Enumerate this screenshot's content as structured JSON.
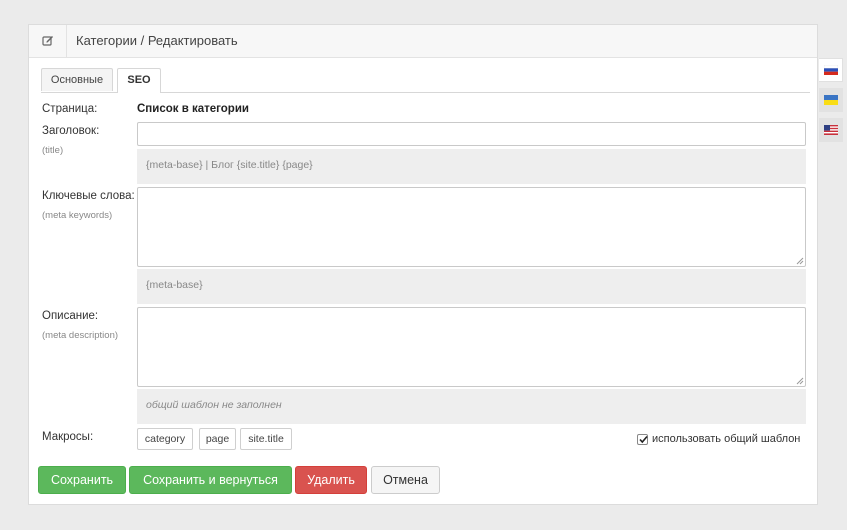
{
  "header": {
    "title": "Категории / Редактировать",
    "icon": "edit-icon"
  },
  "tabs": [
    {
      "label": "Основные",
      "active": false
    },
    {
      "label": "SEO",
      "active": true
    }
  ],
  "form": {
    "page": {
      "label": "Страница:",
      "value": "Список в категории"
    },
    "title": {
      "label": "Заголовок:",
      "sublabel": "(title)",
      "value": "",
      "hint": "{meta-base} | Блог {site.title} {page}"
    },
    "keywords": {
      "label": "Ключевые слова:",
      "sublabel": "(meta keywords)",
      "value": "",
      "hint": "{meta-base}"
    },
    "description": {
      "label": "Описание:",
      "sublabel": "(meta description)",
      "value": "",
      "hint": "общий шаблон не заполнен"
    },
    "macros": {
      "label": "Макросы:",
      "items": [
        "category",
        "page",
        "site.title"
      ]
    },
    "use_common_template": {
      "label": "использовать общий шаблон",
      "checked": true
    }
  },
  "buttons": {
    "save": "Сохранить",
    "save_return": "Сохранить и вернуться",
    "delete": "Удалить",
    "cancel": "Отмена"
  },
  "languages": [
    {
      "code": "ru",
      "icon": "russia-flag-icon",
      "active": true
    },
    {
      "code": "uk",
      "icon": "ukraine-flag-icon",
      "active": false
    },
    {
      "code": "en",
      "icon": "usa-flag-icon",
      "active": false
    }
  ],
  "colors": {
    "success": "#5cb85c",
    "danger": "#d9534f",
    "background": "#ebebeb"
  }
}
